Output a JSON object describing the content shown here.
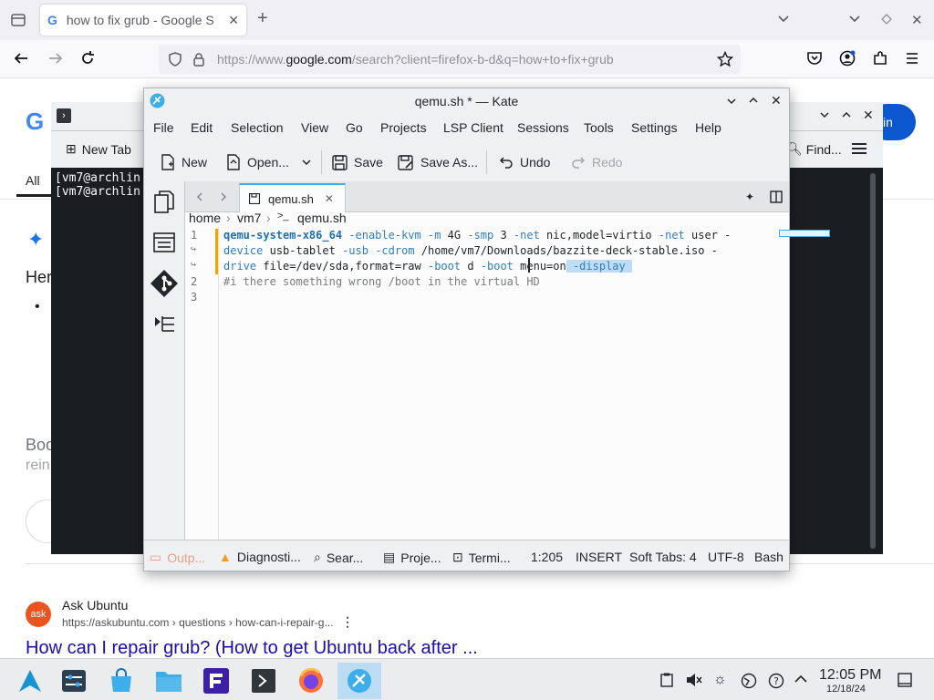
{
  "browser": {
    "tab_title": "how to fix grub - Google S",
    "url_prefix": "https://www.",
    "url_domain": "google.com",
    "url_rest": "/search?client=firefox-b-d&q=how+to+fix+grub"
  },
  "google": {
    "all_tab": "All",
    "partial_1": "Her",
    "partial_2": "Boo",
    "partial_3": "rein",
    "signin": "in",
    "result": {
      "site": "Ask Ubuntu",
      "url": "https://askubuntu.com › questions › how-can-i-repair-g...",
      "title": "How can I repair grub? (How to get Ubuntu back after ..."
    }
  },
  "konsole": {
    "new_tab": "New Tab",
    "find": "Find...",
    "lines": [
      "[vm7@archlin",
      "[vm7@archlin"
    ]
  },
  "kate": {
    "title": "qemu.sh * — Kate",
    "menu": [
      "File",
      "Edit",
      "Selection",
      "View",
      "Go",
      "Projects",
      "LSP Client",
      "Sessions",
      "Tools",
      "Settings",
      "Help"
    ],
    "toolbar": {
      "new": "New",
      "open": "Open...",
      "save": "Save",
      "save_as": "Save As...",
      "undo": "Undo",
      "redo": "Redo"
    },
    "tab_name": "qemu.sh",
    "breadcrumb": [
      "home",
      "vm7",
      "qemu.sh"
    ],
    "code": {
      "line1a_cmd": "qemu-system-x86_64",
      "line1a_rest1": " -enable-kvm",
      "line1a_rest2": " -m",
      "line1a_rest3": " 4G",
      "line1a_rest4": " -smp",
      "line1a_rest5": " 3",
      "line1a_rest6": " -net",
      "line1a_rest7": " nic,model=virtio",
      "line1a_rest8": " -net",
      "line1a_rest9": " user -",
      "line1b_a": "device",
      "line1b_b": " usb-tablet",
      "line1b_c": " -usb",
      "line1b_d": " -cdrom",
      "line1b_e": " /home/vm7/Downloads/bazzite-deck-stable.iso -",
      "line1c_a": "drive",
      "line1c_b": " file=/dev/sda,format=raw",
      "line1c_c": " -boot",
      "line1c_d": " d",
      "line1c_e": " -boot",
      "line1c_f": " menu=on",
      "line1c_sel": " -display ",
      "line2": "#i there something wrong /boot in the virtual HD"
    },
    "line_numbers": [
      "1",
      "2",
      "3"
    ],
    "wrap_marker": "↪",
    "status": {
      "output": "Outp...",
      "diagnostics": "Diagnosti...",
      "search": "Sear...",
      "projects": "Proje...",
      "terminal": "Termi...",
      "position": "1:205",
      "mode": "INSERT",
      "tabs": "Soft Tabs: 4",
      "encoding": "UTF-8",
      "language": "Bash"
    }
  },
  "taskbar": {
    "time": "12:05 PM",
    "date": "12/18/24"
  },
  "colors": {
    "accent": "#3daee9",
    "link": "#1a0dab",
    "google_blue": "#0b57d0"
  }
}
